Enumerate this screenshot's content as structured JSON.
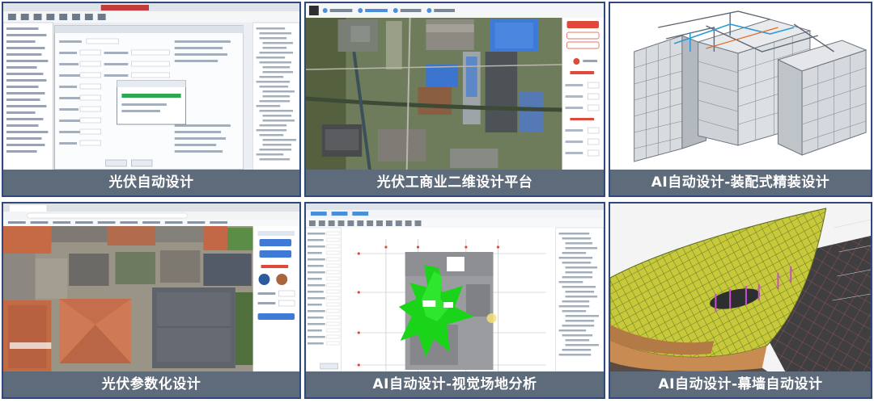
{
  "panels": [
    {
      "id": "pv-auto-design",
      "caption": "光伏自动设计"
    },
    {
      "id": "pv-2d-platform",
      "caption": "光伏工商业二维设计平台"
    },
    {
      "id": "ai-prefab-fitout",
      "caption": "AI自动设计-装配式精装设计"
    },
    {
      "id": "pv-parametric",
      "caption": "光伏参数化设计"
    },
    {
      "id": "ai-site-analysis",
      "caption": "AI自动设计-视觉场地分析"
    },
    {
      "id": "ai-curtain-wall",
      "caption": "AI自动设计-幕墙自动设计"
    }
  ],
  "colors": {
    "caption_bg": "#5e6b7b",
    "panel_border": "#2f4a7a",
    "accent_red": "#e0483a",
    "site_green": "#19d419",
    "curtain_yellow": "#cfd23a",
    "roof_blue": "#3f7ad6"
  }
}
